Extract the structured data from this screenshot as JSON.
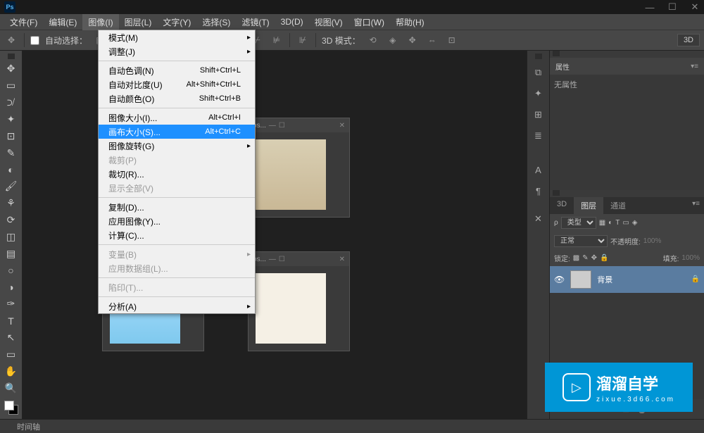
{
  "titlebar": {
    "logo": "Ps"
  },
  "menubar": {
    "items": [
      "文件(F)",
      "编辑(E)",
      "图像(I)",
      "图层(L)",
      "文字(Y)",
      "选择(S)",
      "滤镜(T)",
      "3D(D)",
      "视图(V)",
      "窗口(W)",
      "帮助(H)"
    ]
  },
  "options": {
    "auto_select_label": "自动选择：",
    "mode_3d": "3D 模式：",
    "btn_3d": "3D"
  },
  "dropdown": {
    "groups": [
      [
        {
          "label": "模式(M)",
          "arrow": true
        },
        {
          "label": "调整(J)",
          "arrow": true
        }
      ],
      [
        {
          "label": "自动色调(N)",
          "shortcut": "Shift+Ctrl+L"
        },
        {
          "label": "自动对比度(U)",
          "shortcut": "Alt+Shift+Ctrl+L"
        },
        {
          "label": "自动颜色(O)",
          "shortcut": "Shift+Ctrl+B"
        }
      ],
      [
        {
          "label": "图像大小(I)...",
          "shortcut": "Alt+Ctrl+I"
        },
        {
          "label": "画布大小(S)...",
          "shortcut": "Alt+Ctrl+C",
          "highlighted": true
        },
        {
          "label": "图像旋转(G)",
          "arrow": true
        },
        {
          "label": "裁剪(P)",
          "disabled": true
        },
        {
          "label": "裁切(R)..."
        },
        {
          "label": "显示全部(V)",
          "disabled": true
        }
      ],
      [
        {
          "label": "复制(D)..."
        },
        {
          "label": "应用图像(Y)..."
        },
        {
          "label": "计算(C)..."
        }
      ],
      [
        {
          "label": "变量(B)",
          "arrow": true,
          "disabled": true
        },
        {
          "label": "应用数据组(L)...",
          "disabled": true
        }
      ],
      [
        {
          "label": "陷印(T)...",
          "disabled": true
        }
      ],
      [
        {
          "label": "分析(A)",
          "arrow": true
        }
      ]
    ]
  },
  "docs": {
    "doc1_title": "ps...",
    "doc2_title": "ps...",
    "doc3_title": "ps..."
  },
  "panels": {
    "properties_tab": "属性",
    "no_properties": "无属性",
    "tabs_3d": "3D",
    "tabs_layers": "图层",
    "tabs_channels": "通道",
    "kind_label": "类型",
    "blend_mode": "正常",
    "opacity_label": "不透明度:",
    "opacity_value": "100%",
    "lock_label": "锁定:",
    "fill_label": "填充:",
    "fill_value": "100%",
    "layer_name": "背景"
  },
  "statusbar": {
    "timeline": "时间轴"
  },
  "watermark": {
    "text": "溜溜自学",
    "sub": "zixue.3d66.com"
  }
}
